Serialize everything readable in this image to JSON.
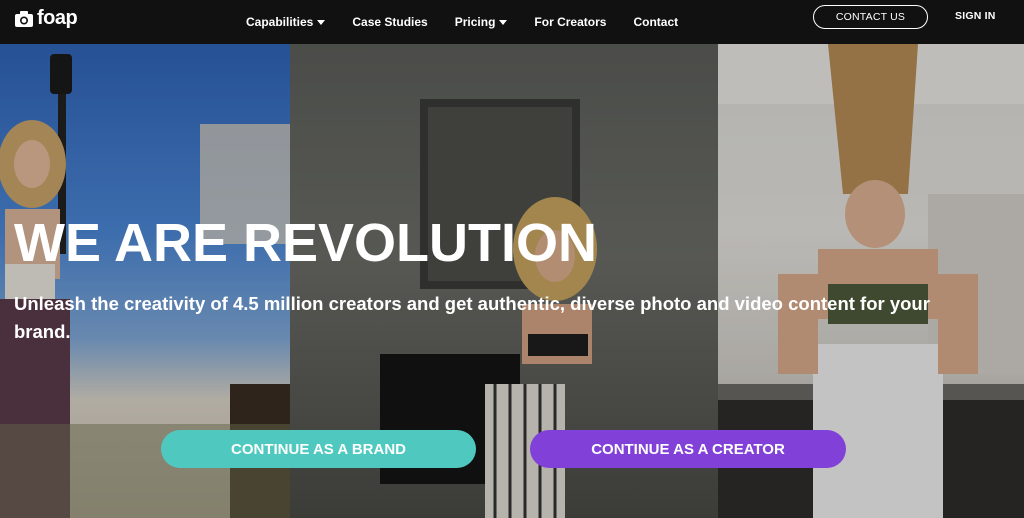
{
  "nav": {
    "brand": "foap",
    "menu": [
      {
        "label": "Capabilities",
        "dropdown": true
      },
      {
        "label": "Case Studies",
        "dropdown": false
      },
      {
        "label": "Pricing",
        "dropdown": true
      },
      {
        "label": "For Creators",
        "dropdown": false
      },
      {
        "label": "Contact",
        "dropdown": false
      }
    ],
    "contact_button": "CONTACT US",
    "sign_in": "SIGN IN"
  },
  "hero": {
    "headline": "WE ARE REVOLUTION",
    "subheadline": "Unleash the creativity of 4.5 million creators and get authentic, diverse photo and video content for your brand.",
    "brand_button": "CONTINUE AS A BRAND",
    "creator_button": "CONTINUE AS A CREATOR"
  },
  "colors": {
    "nav_bg": "#111111",
    "brand_button": "#4fc9bf",
    "creator_button": "#8141d8"
  }
}
